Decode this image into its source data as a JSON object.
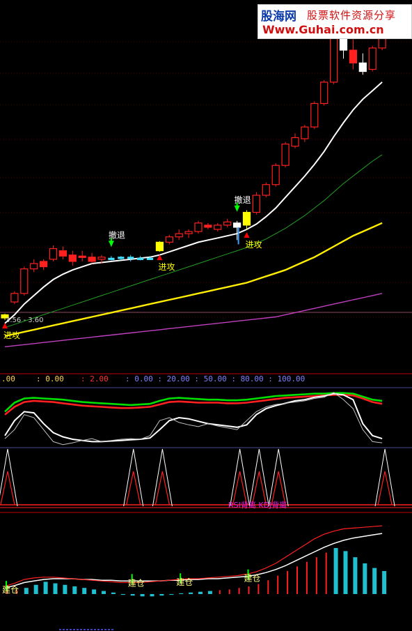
{
  "logo": {
    "brand": "股海网",
    "slogan": "股票软件资源分享",
    "url": "Www.Guhai.com.cn"
  },
  "header_values": [
    {
      "text": ".00",
      "color": "#ffd24a"
    },
    {
      "text": ": 0.00",
      "color": "#ffd24a"
    },
    {
      "text": ": 2.00",
      "color": "#ff3030"
    },
    {
      "text": ": 0.00 : 20.00 : 50.00 : 80.00 : 100.00",
      "color": "#8080ff"
    }
  ],
  "chart_data": [
    {
      "type": "candlestick",
      "price_range": "3.56 - 3.60",
      "annotations": [
        {
          "text": "撤退",
          "bar": 11,
          "color": "#ffffff",
          "arrow": "down",
          "arrow_color": "#00ff00"
        },
        {
          "text": "进攻",
          "bar": 0,
          "color": "#ffff00",
          "arrow": "up",
          "arrow_color": "#ff0000"
        },
        {
          "text": "进攻",
          "bar": 16,
          "color": "#ffff00",
          "arrow": "up",
          "arrow_color": "#ff0000"
        },
        {
          "text": "撤退",
          "bar": 24,
          "color": "#ffffff",
          "arrow": "down",
          "arrow_color": "#00ff00"
        },
        {
          "text": "进攻",
          "bar": 25,
          "color": "#ffff00",
          "arrow": "up",
          "arrow_color": "#ff0000"
        }
      ],
      "candles": [
        {
          "o": 3.57,
          "h": 3.61,
          "l": 3.55,
          "c": 3.6,
          "style": "yellow"
        },
        {
          "o": 3.72,
          "h": 3.82,
          "l": 3.7,
          "c": 3.8,
          "style": "up"
        },
        {
          "o": 3.8,
          "h": 4.05,
          "l": 3.78,
          "c": 4.03,
          "style": "up"
        },
        {
          "o": 4.03,
          "h": 4.12,
          "l": 4.0,
          "c": 4.08,
          "style": "up"
        },
        {
          "o": 4.1,
          "h": 4.12,
          "l": 4.02,
          "c": 4.05,
          "style": "down"
        },
        {
          "o": 4.12,
          "h": 4.25,
          "l": 4.1,
          "c": 4.22,
          "style": "up"
        },
        {
          "o": 4.2,
          "h": 4.24,
          "l": 4.12,
          "c": 4.15,
          "style": "down"
        },
        {
          "o": 4.16,
          "h": 4.2,
          "l": 4.06,
          "c": 4.1,
          "style": "down"
        },
        {
          "o": 4.15,
          "h": 4.2,
          "l": 4.1,
          "c": 4.14,
          "style": "down"
        },
        {
          "o": 4.14,
          "h": 4.18,
          "l": 4.08,
          "c": 4.1,
          "style": "down"
        },
        {
          "o": 4.12,
          "h": 4.16,
          "l": 4.08,
          "c": 4.14,
          "style": "up"
        },
        {
          "o": 4.13,
          "h": 4.15,
          "l": 4.11,
          "c": 4.13,
          "style": "cyan"
        },
        {
          "o": 4.13,
          "h": 4.15,
          "l": 4.11,
          "c": 4.14,
          "style": "cyan"
        },
        {
          "o": 4.14,
          "h": 4.16,
          "l": 4.1,
          "c": 4.13,
          "style": "cyan"
        },
        {
          "o": 4.13,
          "h": 4.15,
          "l": 4.11,
          "c": 4.12,
          "style": "cyan"
        },
        {
          "o": 4.13,
          "h": 4.15,
          "l": 4.12,
          "c": 4.13,
          "style": "cyan"
        },
        {
          "o": 4.2,
          "h": 4.29,
          "l": 4.19,
          "c": 4.28,
          "style": "yellow"
        },
        {
          "o": 4.28,
          "h": 4.35,
          "l": 4.26,
          "c": 4.33,
          "style": "up"
        },
        {
          "o": 4.33,
          "h": 4.4,
          "l": 4.3,
          "c": 4.36,
          "style": "up"
        },
        {
          "o": 4.36,
          "h": 4.4,
          "l": 4.32,
          "c": 4.38,
          "style": "up"
        },
        {
          "o": 4.38,
          "h": 4.48,
          "l": 4.36,
          "c": 4.46,
          "style": "up"
        },
        {
          "o": 4.44,
          "h": 4.46,
          "l": 4.4,
          "c": 4.42,
          "style": "down"
        },
        {
          "o": 4.4,
          "h": 4.46,
          "l": 4.38,
          "c": 4.44,
          "style": "up"
        },
        {
          "o": 4.44,
          "h": 4.5,
          "l": 4.42,
          "c": 4.47,
          "style": "up"
        },
        {
          "o": 4.46,
          "h": 4.48,
          "l": 4.3,
          "c": 4.42,
          "style": "white"
        },
        {
          "o": 4.44,
          "h": 4.58,
          "l": 4.4,
          "c": 4.56,
          "style": "yellow"
        },
        {
          "o": 4.56,
          "h": 4.75,
          "l": 4.54,
          "c": 4.72,
          "style": "up"
        },
        {
          "o": 4.72,
          "h": 4.84,
          "l": 4.7,
          "c": 4.82,
          "style": "up"
        },
        {
          "o": 4.82,
          "h": 5.02,
          "l": 4.8,
          "c": 5.0,
          "style": "up"
        },
        {
          "o": 5.0,
          "h": 5.22,
          "l": 4.98,
          "c": 5.2,
          "style": "up"
        },
        {
          "o": 5.18,
          "h": 5.3,
          "l": 5.16,
          "c": 5.26,
          "style": "up"
        },
        {
          "o": 5.25,
          "h": 5.38,
          "l": 5.22,
          "c": 5.36,
          "style": "up"
        },
        {
          "o": 5.36,
          "h": 5.6,
          "l": 5.34,
          "c": 5.58,
          "style": "up"
        },
        {
          "o": 5.58,
          "h": 5.8,
          "l": 5.56,
          "c": 5.78,
          "style": "up"
        },
        {
          "o": 5.78,
          "h": 6.3,
          "l": 5.76,
          "c": 6.25,
          "style": "up"
        },
        {
          "o": 6.25,
          "h": 6.35,
          "l": 6.0,
          "c": 6.08,
          "style": "white"
        },
        {
          "o": 6.08,
          "h": 6.18,
          "l": 5.9,
          "c": 5.96,
          "style": "down"
        },
        {
          "o": 5.96,
          "h": 6.05,
          "l": 5.85,
          "c": 5.88,
          "style": "white"
        },
        {
          "o": 5.9,
          "h": 6.12,
          "l": 5.88,
          "c": 6.1,
          "style": "up"
        },
        {
          "o": 6.1,
          "h": 6.3,
          "l": 6.08,
          "c": 6.25,
          "style": "up"
        }
      ],
      "ma_white": [
        3.52,
        3.6,
        3.7,
        3.78,
        3.86,
        3.93,
        3.98,
        4.02,
        4.05,
        4.08,
        4.09,
        4.1,
        4.11,
        4.12,
        4.13,
        4.14,
        4.16,
        4.19,
        4.22,
        4.25,
        4.28,
        4.3,
        4.32,
        4.34,
        4.36,
        4.4,
        4.45,
        4.52,
        4.6,
        4.7,
        4.8,
        4.9,
        5.01,
        5.13,
        5.27,
        5.4,
        5.52,
        5.62,
        5.7,
        5.78
      ],
      "ma_green": [
        3.48,
        3.51,
        3.54,
        3.57,
        3.6,
        3.63,
        3.66,
        3.69,
        3.72,
        3.75,
        3.78,
        3.81,
        3.84,
        3.87,
        3.9,
        3.93,
        3.96,
        3.99,
        4.02,
        4.05,
        4.08,
        4.11,
        4.14,
        4.17,
        4.2,
        4.23,
        4.27,
        4.31,
        4.36,
        4.41,
        4.47,
        4.53,
        4.6,
        4.67,
        4.75,
        4.83,
        4.9,
        4.97,
        5.04,
        5.1
      ],
      "ma_yellow": [
        3.4,
        3.42,
        3.44,
        3.46,
        3.48,
        3.5,
        3.52,
        3.54,
        3.56,
        3.58,
        3.6,
        3.62,
        3.64,
        3.66,
        3.68,
        3.7,
        3.72,
        3.74,
        3.76,
        3.78,
        3.8,
        3.82,
        3.84,
        3.86,
        3.88,
        3.9,
        3.93,
        3.96,
        3.99,
        4.02,
        4.06,
        4.1,
        4.14,
        4.19,
        4.24,
        4.29,
        4.34,
        4.38,
        4.42,
        4.46
      ],
      "ma_magenta": [
        3.3,
        3.31,
        3.32,
        3.33,
        3.34,
        3.35,
        3.36,
        3.37,
        3.38,
        3.39,
        3.4,
        3.41,
        3.42,
        3.43,
        3.44,
        3.45,
        3.46,
        3.47,
        3.48,
        3.49,
        3.5,
        3.51,
        3.52,
        3.53,
        3.54,
        3.55,
        3.56,
        3.57,
        3.58,
        3.6,
        3.62,
        3.64,
        3.66,
        3.68,
        3.7,
        3.72,
        3.74,
        3.76,
        3.78,
        3.8
      ]
    },
    {
      "type": "line",
      "ylim": [
        0,
        100
      ],
      "series": [
        {
          "color": "#00e000",
          "values": [
            60,
            75,
            82,
            83,
            82,
            81,
            80,
            78,
            76,
            75,
            74,
            73,
            72,
            71,
            72,
            73,
            78,
            82,
            83,
            82,
            81,
            80,
            80,
            79,
            79,
            80,
            82,
            84,
            86,
            87,
            88,
            89,
            90,
            90,
            91,
            91,
            90,
            85,
            80,
            78
          ]
        },
        {
          "color": "#ff2020",
          "values": [
            55,
            68,
            76,
            78,
            77,
            76,
            74,
            72,
            70,
            69,
            68,
            67,
            66,
            66,
            67,
            68,
            72,
            76,
            77,
            76,
            75,
            75,
            75,
            74,
            74,
            75,
            77,
            79,
            81,
            83,
            84,
            85,
            86,
            87,
            88,
            88,
            87,
            82,
            76,
            73
          ]
        },
        {
          "color": "#ffffff",
          "values": [
            20,
            45,
            60,
            58,
            40,
            25,
            18,
            14,
            12,
            10,
            10,
            11,
            12,
            13,
            14,
            16,
            30,
            45,
            50,
            48,
            44,
            40,
            38,
            36,
            34,
            38,
            55,
            65,
            70,
            74,
            78,
            80,
            84,
            86,
            90,
            88,
            80,
            40,
            20,
            15
          ]
        },
        {
          "color": "#c0c0c0",
          "values": [
            15,
            30,
            55,
            50,
            30,
            10,
            5,
            8,
            12,
            15,
            10,
            12,
            14,
            15,
            14,
            20,
            45,
            50,
            42,
            38,
            35,
            40,
            36,
            33,
            30,
            45,
            60,
            68,
            72,
            74,
            76,
            78,
            82,
            84,
            92,
            80,
            65,
            30,
            10,
            8
          ]
        }
      ]
    },
    {
      "type": "line",
      "labels": [
        "RSI背离",
        "KDJ背离"
      ],
      "spikes": [
        0,
        13,
        16,
        24,
        26,
        28,
        39
      ]
    },
    {
      "type": "bar",
      "labels": [
        "建仓",
        "建仓",
        "建仓",
        "建仓"
      ],
      "label_bars": [
        0,
        13,
        18,
        25
      ],
      "values": [
        0.5,
        0.6,
        0.8,
        1.2,
        1.6,
        1.4,
        1.2,
        1.0,
        0.8,
        0.6,
        0.4,
        0.2,
        -0.1,
        -0.2,
        -0.3,
        -0.3,
        -0.2,
        -0.1,
        0.1,
        0.2,
        0.3,
        0.4,
        0.5,
        0.6,
        0.8,
        1.0,
        1.3,
        1.8,
        2.4,
        3.0,
        3.6,
        4.2,
        4.8,
        5.4,
        6.0,
        5.6,
        4.8,
        4.0,
        3.4,
        3.0
      ],
      "colors": [
        "r",
        "r",
        "c",
        "c",
        "c",
        "c",
        "c",
        "c",
        "c",
        "c",
        "c",
        "c",
        "c",
        "c",
        "c",
        "c",
        "c",
        "c",
        "c",
        "c",
        "c",
        "c",
        "r",
        "r",
        "r",
        "r",
        "r",
        "r",
        "r",
        "r",
        "r",
        "r",
        "r",
        "r",
        "c",
        "c",
        "c",
        "c",
        "c",
        "c"
      ],
      "line_red": [
        1.0,
        1.4,
        1.9,
        2.1,
        2.2,
        2.2,
        2.1,
        2.0,
        1.9,
        1.8,
        1.7,
        1.6,
        1.5,
        1.5,
        1.5,
        1.6,
        1.7,
        1.8,
        1.9,
        2.0,
        2.0,
        2.1,
        2.2,
        2.3,
        2.4,
        2.6,
        2.9,
        3.4,
        4.0,
        4.8,
        5.6,
        6.4,
        7.2,
        7.8,
        8.2,
        8.5,
        8.6,
        8.7,
        8.8,
        8.9
      ],
      "line_white": [
        0.8,
        1.1,
        1.5,
        1.7,
        1.9,
        2.0,
        2.0,
        2.0,
        1.9,
        1.9,
        1.8,
        1.8,
        1.7,
        1.7,
        1.7,
        1.7,
        1.7,
        1.8,
        1.8,
        1.9,
        1.9,
        2.0,
        2.0,
        2.1,
        2.2,
        2.3,
        2.5,
        2.8,
        3.2,
        3.7,
        4.3,
        4.9,
        5.5,
        6.1,
        6.6,
        7.0,
        7.3,
        7.5,
        7.7,
        7.9
      ]
    }
  ]
}
